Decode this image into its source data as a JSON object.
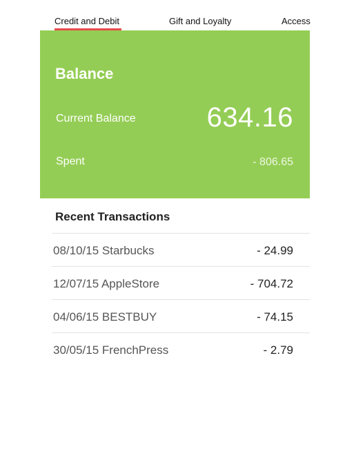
{
  "tabs": [
    {
      "label": "Credit and Debit",
      "selected": true
    },
    {
      "label": "Gift and Loyalty",
      "selected": false
    },
    {
      "label": "Access",
      "selected": false
    }
  ],
  "colors": {
    "card_background": "#94cd55",
    "tab_indicator": "#e94b4b"
  },
  "balance_card": {
    "title": "Balance",
    "current_label": "Current Balance",
    "current_value": "634.16",
    "spent_label": "Spent",
    "spent_value": "- 806.65"
  },
  "transactions": {
    "title": "Recent Transactions",
    "items": [
      {
        "description": "08/10/15 Starbucks",
        "amount": "- 24.99"
      },
      {
        "description": "12/07/15 AppleStore",
        "amount": "- 704.72"
      },
      {
        "description": "04/06/15 BESTBUY",
        "amount": "- 74.15"
      },
      {
        "description": "30/05/15 FrenchPress",
        "amount": "- 2.79"
      }
    ]
  }
}
